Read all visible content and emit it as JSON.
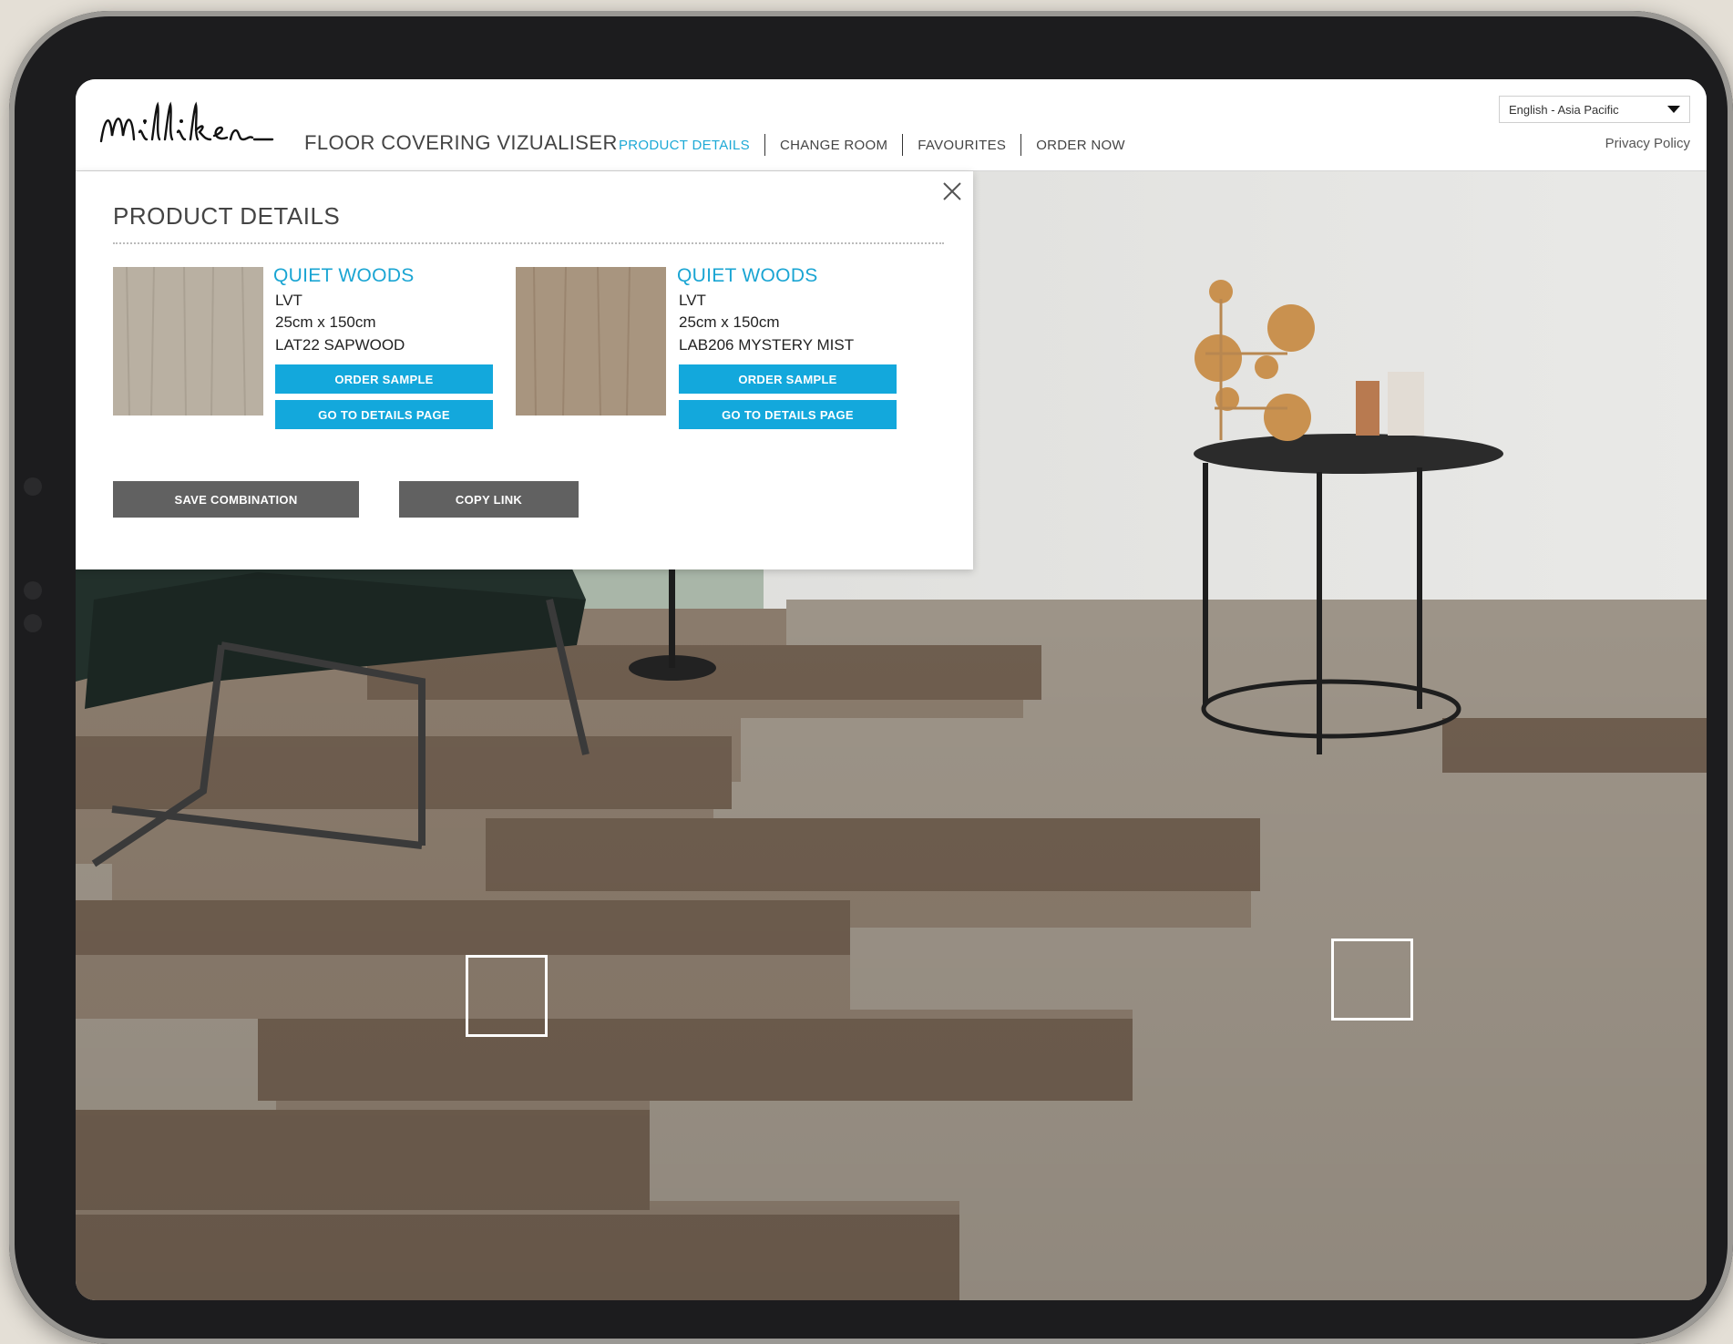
{
  "header": {
    "brand": "Milliken",
    "app_title": "FLOOR COVERING VIZUALISER",
    "nav": [
      {
        "label": "PRODUCT DETAILS",
        "active": true
      },
      {
        "label": "CHANGE ROOM",
        "active": false
      },
      {
        "label": "FAVOURITES",
        "active": false
      },
      {
        "label": "ORDER NOW",
        "active": false
      }
    ],
    "language": "English - Asia Pacific",
    "privacy": "Privacy Policy"
  },
  "panel": {
    "title": "PRODUCT DETAILS",
    "products": [
      {
        "name": "QUIET WOODS",
        "type": "LVT",
        "size": "25cm x 150cm",
        "code": "LAT22 SAPWOOD",
        "order_label": "ORDER SAMPLE",
        "details_label": "GO TO DETAILS PAGE"
      },
      {
        "name": "QUIET WOODS",
        "type": "LVT",
        "size": "25cm x 150cm",
        "code": "LAB206 MYSTERY MIST",
        "order_label": "ORDER SAMPLE",
        "details_label": "GO TO DETAILS PAGE"
      }
    ],
    "save_label": "SAVE COMBINATION",
    "copy_label": "COPY LINK"
  },
  "colors": {
    "accent": "#13a8dc",
    "button_gray": "#616161",
    "title_blue": "#1aa5d3"
  }
}
